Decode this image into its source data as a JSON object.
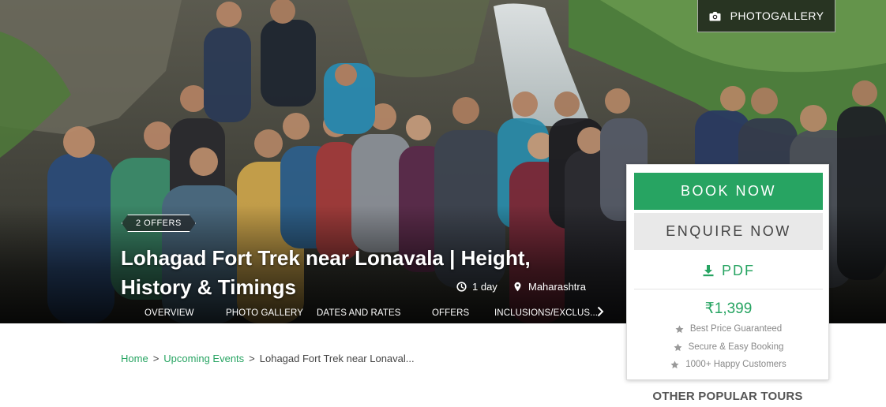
{
  "hero": {
    "photo_alt": "",
    "photogallery_label": "PHOTOGALLERY",
    "offers_badge": "2 OFFERS",
    "title": "Lohagad Fort Trek near Lonavala | Height, History & Timings",
    "duration": "1 day",
    "location": "Maharashtra"
  },
  "tabs": [
    {
      "label": "OVERVIEW"
    },
    {
      "label": "PHOTO GALLERY"
    },
    {
      "label": "DATES AND RATES"
    },
    {
      "label": "OFFERS"
    },
    {
      "label": "INCLUSIONS/EXCLUS..."
    }
  ],
  "booking": {
    "book_label": "BOOK NOW",
    "enquire_label": "ENQUIRE NOW",
    "pdf_label": "PDF",
    "price": "₹1,399",
    "features": [
      "Best Price Guaranteed",
      "Secure & Easy Booking",
      "1000+ Happy Customers"
    ]
  },
  "breadcrumb": {
    "home": "Home",
    "section": "Upcoming Events",
    "current": "Lohagad Fort Trek near Lonaval...",
    "separator": ">"
  },
  "sidebar": {
    "other_tours_heading": "OTHER POPULAR TOURS"
  },
  "colors": {
    "accent_green": "#27a462",
    "enquire_bg": "#e9e9e9"
  },
  "icons": {
    "photogallery": "camera-icon",
    "duration": "clock-icon",
    "location": "map-pin-icon",
    "tabs_next": "chevron-right-icon",
    "pdf": "download-icon",
    "feature": "star-icon"
  }
}
